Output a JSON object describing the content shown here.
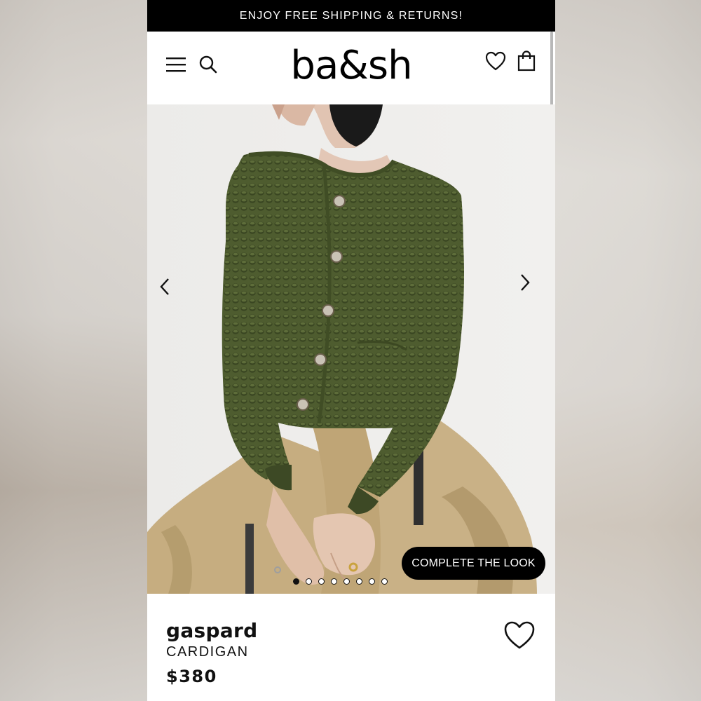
{
  "promo_bar": {
    "text": "ENJOY FREE SHIPPING & RETURNS!"
  },
  "header": {
    "logo": "ba&sh",
    "icons": [
      "menu-icon",
      "search-icon",
      "heart-icon",
      "shopping-bag-icon"
    ]
  },
  "gallery": {
    "image_alt": "gaspard cardigan",
    "cta_label": "COMPLETE THE LOOK",
    "slide_count": 8,
    "active_slide": 1,
    "prev_icon": "chevron-left-icon",
    "next_icon": "chevron-right-icon"
  },
  "product": {
    "name": "gaspard",
    "type": "CARDIGAN",
    "price": "$380",
    "wishlist_icon": "heart-icon"
  },
  "colors": {
    "promo_bg": "#000000",
    "cardigan": "#4b5a2e",
    "trousers": "#c8b084",
    "background": "#eeeceb"
  }
}
